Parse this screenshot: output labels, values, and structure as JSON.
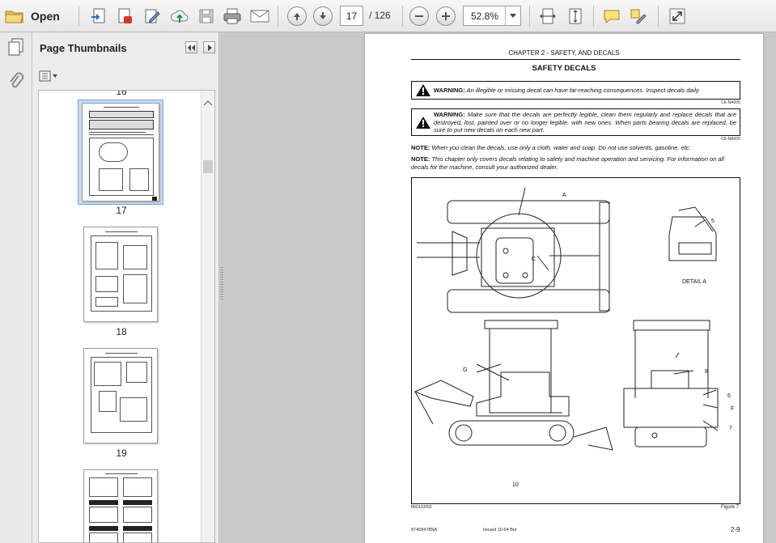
{
  "toolbar": {
    "open_label": "Open",
    "page_current": "17",
    "page_total": "/ 126",
    "zoom": "52.8%"
  },
  "icons": [
    "folder-icon",
    "export-icon",
    "create-pdf-icon",
    "edit-icon",
    "upload-icon",
    "save-icon",
    "print-icon",
    "email-icon",
    "prev-page-icon",
    "next-page-icon",
    "zoom-out-icon",
    "zoom-in-icon",
    "fit-width-icon",
    "fit-page-icon",
    "comment-icon",
    "highlight-icon",
    "expand-icon"
  ],
  "panel": {
    "title": "Page Thumbnails",
    "thumbnails": [
      {
        "label": "16"
      },
      {
        "label": "17"
      },
      {
        "label": "18"
      },
      {
        "label": "19"
      }
    ]
  },
  "document": {
    "chapter": "CHAPTER 2 - SAFETY, AND DECALS",
    "heading": "SAFETY DECALS",
    "warning1_label": "WARNING:",
    "warning1_text": "An illegible or missing decal can have far-reaching consequences. Inspect decals daily.",
    "warning1_code": "CE-NA000",
    "warning2_label": "WARNING:",
    "warning2_text": "Make sure that the decals are perfectly legible, clean them regularly and replace decals that are destroyed, lost, painted over or no longer legible, with new ones. When parts bearing decals are replaced, be sure to put new decals on each new part.",
    "warning2_code": "CE-NA000",
    "note1_label": "NOTE:",
    "note1_text": "When you clean the decals, use only a cloth, water and soap. Do not use solvents, gasoline, etc.",
    "note2_label": "NOTE:",
    "note2_text": "This chapter only covers decals relating to safety and machine operation and servicing. For information on all decals for the machine, consult your authorized dealer.",
    "figure": {
      "callouts": [
        "A",
        "C",
        "5",
        "DETAIL A",
        "G",
        "B",
        "6",
        "F",
        "7",
        "10"
      ],
      "code": "8504JU053",
      "caption": "Figure 7"
    },
    "footer_left": "87458478NA",
    "footer_mid": "Issued 10-04   Bur",
    "footer_right": "2-9"
  }
}
